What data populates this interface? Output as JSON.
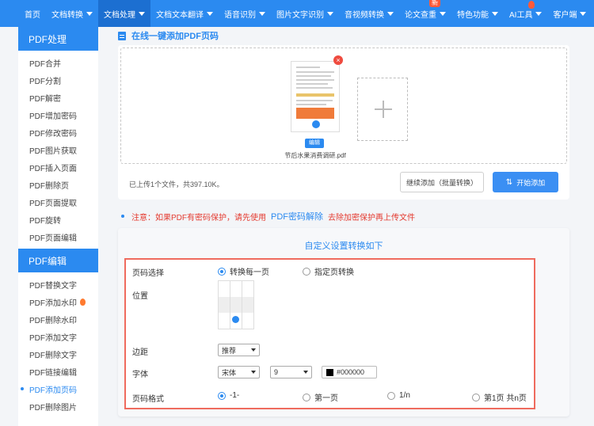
{
  "topnav": {
    "items": [
      {
        "label": "首页"
      },
      {
        "label": "文档转换"
      },
      {
        "label": "文档处理"
      },
      {
        "label": "文档文本翻译"
      },
      {
        "label": "语音识别"
      },
      {
        "label": "图片文字识别"
      },
      {
        "label": "音视频转换"
      },
      {
        "label": "论文查重"
      },
      {
        "label": "特色功能"
      },
      {
        "label": "AI工具"
      },
      {
        "label": "客户端"
      }
    ],
    "new_badge": "新"
  },
  "sidebar": {
    "group1_title": "PDF处理",
    "group1_items": [
      "PDF合并",
      "PDF分割",
      "PDF解密",
      "PDF增加密码",
      "PDF修改密码",
      "PDF图片获取",
      "PDF插入页面",
      "PDF删除页",
      "PDF页面提取",
      "PDF旋转",
      "PDF页面编辑"
    ],
    "group2_title": "PDF编辑",
    "group2_items": [
      "PDF替换文字",
      "PDF添加水印",
      "PDF删除水印",
      "PDF添加文字",
      "PDF删除文字",
      "PDF链接编辑",
      "PDF添加页码",
      "PDF删除图片"
    ]
  },
  "main": {
    "title": "在线一键添加PDF页码",
    "upload": {
      "file_name": "节后水果消费调研.pdf",
      "edit_label": "编辑",
      "remove_label": "×",
      "status": "已上传1个文件，共397.10K。",
      "continue_label": "继续添加（批量转换）",
      "start_label": "开始添加"
    },
    "notice": {
      "prefix": "注意：如果PDF有密码保护，请先使用",
      "link": "PDF密码解除",
      "suffix": "去除加密保护再上传文件"
    },
    "settings": {
      "title": "自定义设置转换如下",
      "page_select_label": "页码选择",
      "page_options": [
        "转换每一页",
        "指定页转换"
      ],
      "position_label": "位置",
      "margin_label": "边距",
      "margin_value": "推荐",
      "font_label": "字体",
      "font_value": "宋体",
      "size_value": "9",
      "color_value": "#000000",
      "format_label": "页码格式",
      "format_options": [
        "-1-",
        "第一页",
        "1/n",
        "第1页 共n页"
      ]
    }
  },
  "colors": {
    "brand": "#2b8af0",
    "warning": "#e43a2f",
    "highlight_border": "#ef6b5e"
  }
}
